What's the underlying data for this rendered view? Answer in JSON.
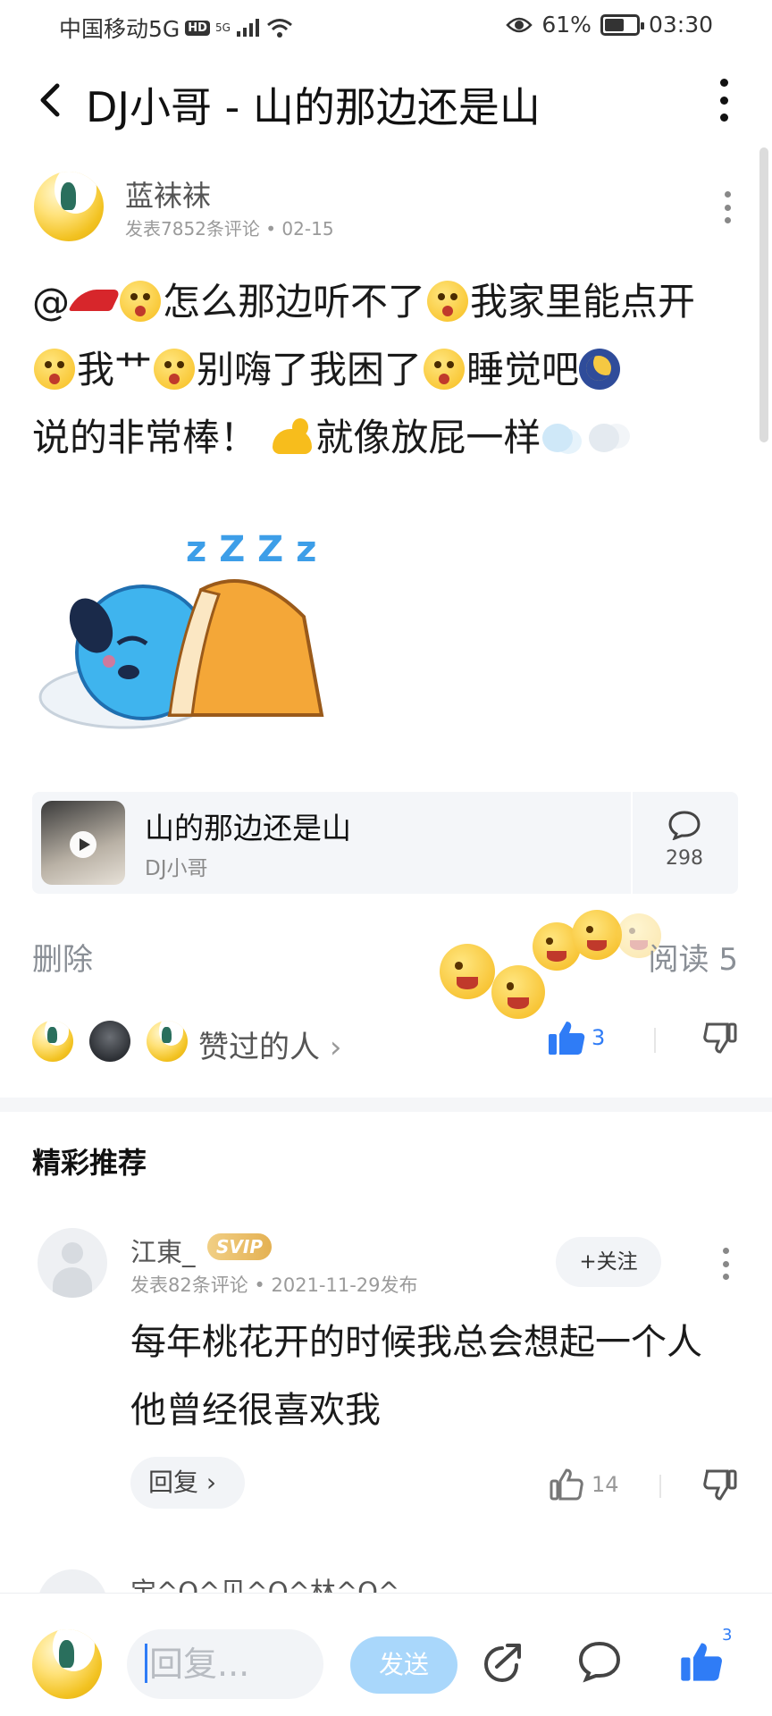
{
  "status_bar": {
    "carrier": "中国移动5G",
    "hd_badge": "HD",
    "network": "5G",
    "battery_percent": "61%",
    "battery_level": 0.61,
    "time": "03:30"
  },
  "header": {
    "title": "DJ小哥 - 山的那边还是山"
  },
  "post": {
    "author_name": "蓝袜袜",
    "author_meta": "发表7852条评论",
    "date": "02-15",
    "at_symbol": "@",
    "text_1": "怎么那边听不了",
    "text_2": "我家里能点开",
    "text_3": "我艹",
    "text_4": "别嗨了我困了",
    "text_5": "睡觉吧",
    "text_6": "说的非常棒！",
    "text_7": "就像放屁一样",
    "sticker_zzz": "z Z Z z"
  },
  "song_card": {
    "title": "山的那边还是山",
    "artist": "DJ小哥",
    "comment_count": "298"
  },
  "actions": {
    "delete": "删除",
    "read_label": "阅读 5",
    "likers_label": "赞过的人",
    "likers_chevron": "›",
    "like_count": "3"
  },
  "recommend": {
    "section_title": "精彩推荐",
    "comment": {
      "name": "江東_",
      "vip_badge": "SVIP",
      "meta": "发表82条评论",
      "date": "2021-11-29发布",
      "follow": "+关注",
      "text": "每年桃花开的时候我总会想起一个人 他曾经很喜欢我",
      "reply": "回复",
      "reply_chevron": "›",
      "like_count": "14"
    },
    "next_peek": "宝^O^贝^O^林^O^"
  },
  "bottom_bar": {
    "placeholder": "回复...",
    "send": "发送",
    "like_badge": "3"
  },
  "colors": {
    "accent_blue": "#2f7cf6",
    "send_disabled": "#a9d7fb",
    "svip_gold": "#e4b153"
  }
}
